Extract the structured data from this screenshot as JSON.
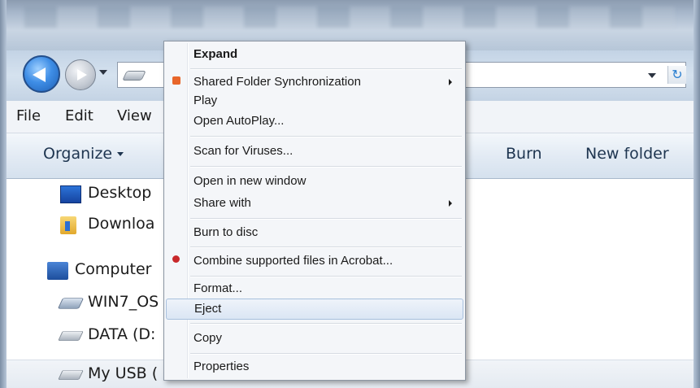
{
  "menubar": {
    "items": [
      "File",
      "Edit",
      "View"
    ]
  },
  "toolbar": {
    "organize": "Organize",
    "burn": "Burn",
    "new_folder": "New folder"
  },
  "navpane": {
    "desktop": "Desktop",
    "downloads": "Downloa",
    "computer": "Computer",
    "win7": "WIN7_OS",
    "data": "DATA (D:",
    "usb": "My USB ("
  },
  "context_menu": {
    "items": [
      {
        "label": "Expand",
        "bold": true
      },
      {
        "label": "Shared Folder Synchronization",
        "submenu": true,
        "icon": "sync-icon"
      },
      {
        "label": "Play"
      },
      {
        "label": "Open AutoPlay..."
      },
      {
        "label": "Scan for Viruses..."
      },
      {
        "label": "Open in new window"
      },
      {
        "label": "Share with",
        "submenu": true
      },
      {
        "label": "Burn to disc"
      },
      {
        "label": "Combine supported files in Acrobat...",
        "icon": "acrobat-icon"
      },
      {
        "label": "Format..."
      },
      {
        "label": "Eject",
        "highlighted": true
      },
      {
        "label": "Copy"
      },
      {
        "label": "Properties"
      }
    ]
  },
  "colors": {
    "accent": "#3f8ee6",
    "menu_bg": "#f4f6f9",
    "highlight": "#dbe6f4"
  }
}
